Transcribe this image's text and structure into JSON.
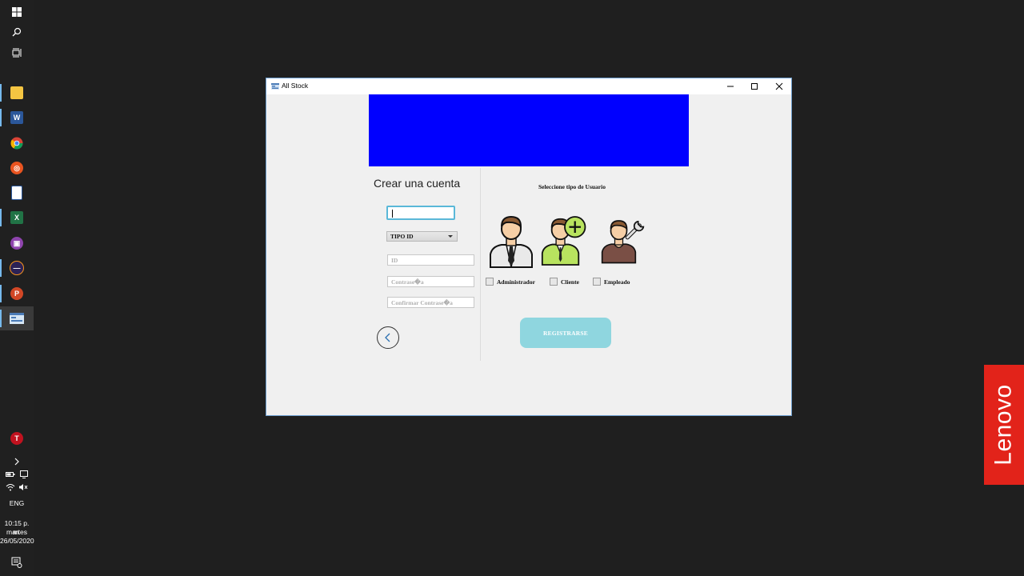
{
  "window": {
    "title": "All Stock",
    "heading": "Crear una cuenta",
    "tipo_id_selected": "TIPO ID",
    "id_placeholder": "ID",
    "password_placeholder": "Contrase�a",
    "confirm_password_placeholder": "Confirmar Contrase�a",
    "user_type_heading": "Seleccione tipo de Usuario",
    "user_types": [
      "Administrador",
      "Cliente",
      "Empleado"
    ],
    "register_label": "REGISTRARSE",
    "banner_color": "#0000ff",
    "register_color": "#8fd6df"
  },
  "taskbar": {
    "language": "ENG",
    "time": "10:15 p. m.",
    "day": "martes",
    "date": "26/05/2020"
  },
  "brand": {
    "lenovo": "Lenovo"
  }
}
